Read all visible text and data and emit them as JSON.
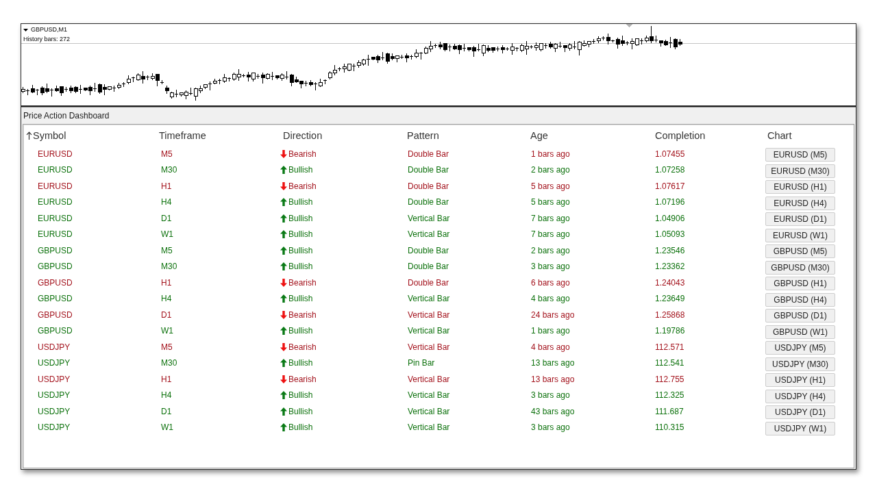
{
  "chart": {
    "symbol_label": "GBPUSD,M1",
    "history": "History bars: 272"
  },
  "dashboard": {
    "title": "Price Action Dashboard",
    "columns": [
      {
        "label": "Symbol",
        "sorted": true
      },
      {
        "label": "Timeframe",
        "sorted": false
      },
      {
        "label": "Direction",
        "sorted": false
      },
      {
        "label": "Pattern",
        "sorted": false
      },
      {
        "label": "Age",
        "sorted": false
      },
      {
        "label": "Completion",
        "sorted": false
      },
      {
        "label": "Chart",
        "sorted": false
      }
    ],
    "rows": [
      {
        "kind": "bearish",
        "symbol": "EURUSD",
        "timeframe": "M5",
        "direction": "Bearish",
        "pattern": "Double Bar",
        "age": "1 bars ago",
        "completion": "1.07455",
        "chart_button": "EURUSD (M5)"
      },
      {
        "kind": "bullish",
        "symbol": "EURUSD",
        "timeframe": "M30",
        "direction": "Bullish",
        "pattern": "Double Bar",
        "age": "2 bars ago",
        "completion": "1.07258",
        "chart_button": "EURUSD (M30)"
      },
      {
        "kind": "bearish",
        "symbol": "EURUSD",
        "timeframe": "H1",
        "direction": "Bearish",
        "pattern": "Double Bar",
        "age": "5 bars ago",
        "completion": "1.07617",
        "chart_button": "EURUSD (H1)"
      },
      {
        "kind": "bullish",
        "symbol": "EURUSD",
        "timeframe": "H4",
        "direction": "Bullish",
        "pattern": "Double Bar",
        "age": "5 bars ago",
        "completion": "1.07196",
        "chart_button": "EURUSD (H4)"
      },
      {
        "kind": "bullish",
        "symbol": "EURUSD",
        "timeframe": "D1",
        "direction": "Bullish",
        "pattern": "Vertical Bar",
        "age": "7 bars ago",
        "completion": "1.04906",
        "chart_button": "EURUSD (D1)"
      },
      {
        "kind": "bullish",
        "symbol": "EURUSD",
        "timeframe": "W1",
        "direction": "Bullish",
        "pattern": "Vertical Bar",
        "age": "7 bars ago",
        "completion": "1.05093",
        "chart_button": "EURUSD (W1)"
      },
      {
        "kind": "bullish",
        "symbol": "GBPUSD",
        "timeframe": "M5",
        "direction": "Bullish",
        "pattern": "Double Bar",
        "age": "2 bars ago",
        "completion": "1.23546",
        "chart_button": "GBPUSD (M5)"
      },
      {
        "kind": "bullish",
        "symbol": "GBPUSD",
        "timeframe": "M30",
        "direction": "Bullish",
        "pattern": "Double Bar",
        "age": "3 bars ago",
        "completion": "1.23362",
        "chart_button": "GBPUSD (M30)"
      },
      {
        "kind": "bearish",
        "symbol": "GBPUSD",
        "timeframe": "H1",
        "direction": "Bearish",
        "pattern": "Double Bar",
        "age": "6 bars ago",
        "completion": "1.24043",
        "chart_button": "GBPUSD (H1)"
      },
      {
        "kind": "bullish",
        "symbol": "GBPUSD",
        "timeframe": "H4",
        "direction": "Bullish",
        "pattern": "Vertical Bar",
        "age": "4 bars ago",
        "completion": "1.23649",
        "chart_button": "GBPUSD (H4)"
      },
      {
        "kind": "bearish",
        "symbol": "GBPUSD",
        "timeframe": "D1",
        "direction": "Bearish",
        "pattern": "Vertical Bar",
        "age": "24 bars ago",
        "completion": "1.25868",
        "chart_button": "GBPUSD (D1)"
      },
      {
        "kind": "bullish",
        "symbol": "GBPUSD",
        "timeframe": "W1",
        "direction": "Bullish",
        "pattern": "Vertical Bar",
        "age": "1 bars ago",
        "completion": "1.19786",
        "chart_button": "GBPUSD (W1)"
      },
      {
        "kind": "bearish",
        "symbol": "USDJPY",
        "timeframe": "M5",
        "direction": "Bearish",
        "pattern": "Vertical Bar",
        "age": "4 bars ago",
        "completion": "112.571",
        "chart_button": "USDJPY (M5)"
      },
      {
        "kind": "bullish",
        "symbol": "USDJPY",
        "timeframe": "M30",
        "direction": "Bullish",
        "pattern": "Pin Bar",
        "age": "13 bars ago",
        "completion": "112.541",
        "chart_button": "USDJPY (M30)"
      },
      {
        "kind": "bearish",
        "symbol": "USDJPY",
        "timeframe": "H1",
        "direction": "Bearish",
        "pattern": "Vertical Bar",
        "age": "13 bars ago",
        "completion": "112.755",
        "chart_button": "USDJPY (H1)"
      },
      {
        "kind": "bullish",
        "symbol": "USDJPY",
        "timeframe": "H4",
        "direction": "Bullish",
        "pattern": "Vertical Bar",
        "age": "3 bars ago",
        "completion": "112.325",
        "chart_button": "USDJPY (H4)"
      },
      {
        "kind": "bullish",
        "symbol": "USDJPY",
        "timeframe": "D1",
        "direction": "Bullish",
        "pattern": "Vertical Bar",
        "age": "43 bars ago",
        "completion": "111.687",
        "chart_button": "USDJPY (D1)"
      },
      {
        "kind": "bullish",
        "symbol": "USDJPY",
        "timeframe": "W1",
        "direction": "Bullish",
        "pattern": "Vertical Bar",
        "age": "3 bars ago",
        "completion": "110.315",
        "chart_button": "USDJPY (W1)"
      }
    ]
  }
}
